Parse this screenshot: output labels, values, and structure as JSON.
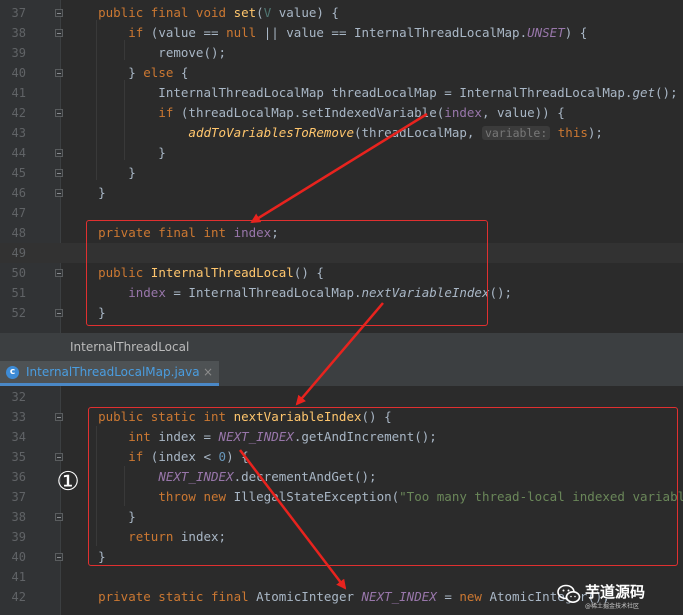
{
  "top_editor": {
    "lines": [
      {
        "num": "37",
        "fold": true
      },
      {
        "num": "38",
        "fold": true
      },
      {
        "num": "39"
      },
      {
        "num": "40",
        "fold": true
      },
      {
        "num": "41"
      },
      {
        "num": "42",
        "fold": true
      },
      {
        "num": "43"
      },
      {
        "num": "44",
        "fold": true
      },
      {
        "num": "45",
        "fold": true
      },
      {
        "num": "46",
        "fold": true
      },
      {
        "num": "47"
      },
      {
        "num": "48"
      },
      {
        "num": "49"
      },
      {
        "num": "50",
        "fold": true
      },
      {
        "num": "51"
      },
      {
        "num": "52",
        "fold": true
      }
    ],
    "param_hint": "variable:"
  },
  "tooltip_text": "InternalThreadLocal",
  "tab": {
    "label": "InternalThreadLocalMap.java",
    "icon_letter": "c",
    "close_symbol": "×"
  },
  "bottom_editor": {
    "lines": [
      {
        "num": "32"
      },
      {
        "num": "33",
        "fold": true
      },
      {
        "num": "34"
      },
      {
        "num": "35",
        "fold": true
      },
      {
        "num": "36"
      },
      {
        "num": "37"
      },
      {
        "num": "38",
        "fold": true
      },
      {
        "num": "39"
      },
      {
        "num": "40",
        "fold": true
      },
      {
        "num": "41"
      },
      {
        "num": "42"
      }
    ]
  },
  "annotation_marker": "①",
  "watermark": {
    "title": "芋道源码",
    "subtitle": "@稀土掘金技术社区"
  },
  "colors": {
    "background": "#2b2b2b",
    "keyword": "#cc7832",
    "method": "#ffc66d",
    "field": "#9876aa",
    "string": "#6a8759",
    "number": "#6897bb",
    "highlight_box": "#e03030",
    "tab_underline": "#4a88c7"
  }
}
